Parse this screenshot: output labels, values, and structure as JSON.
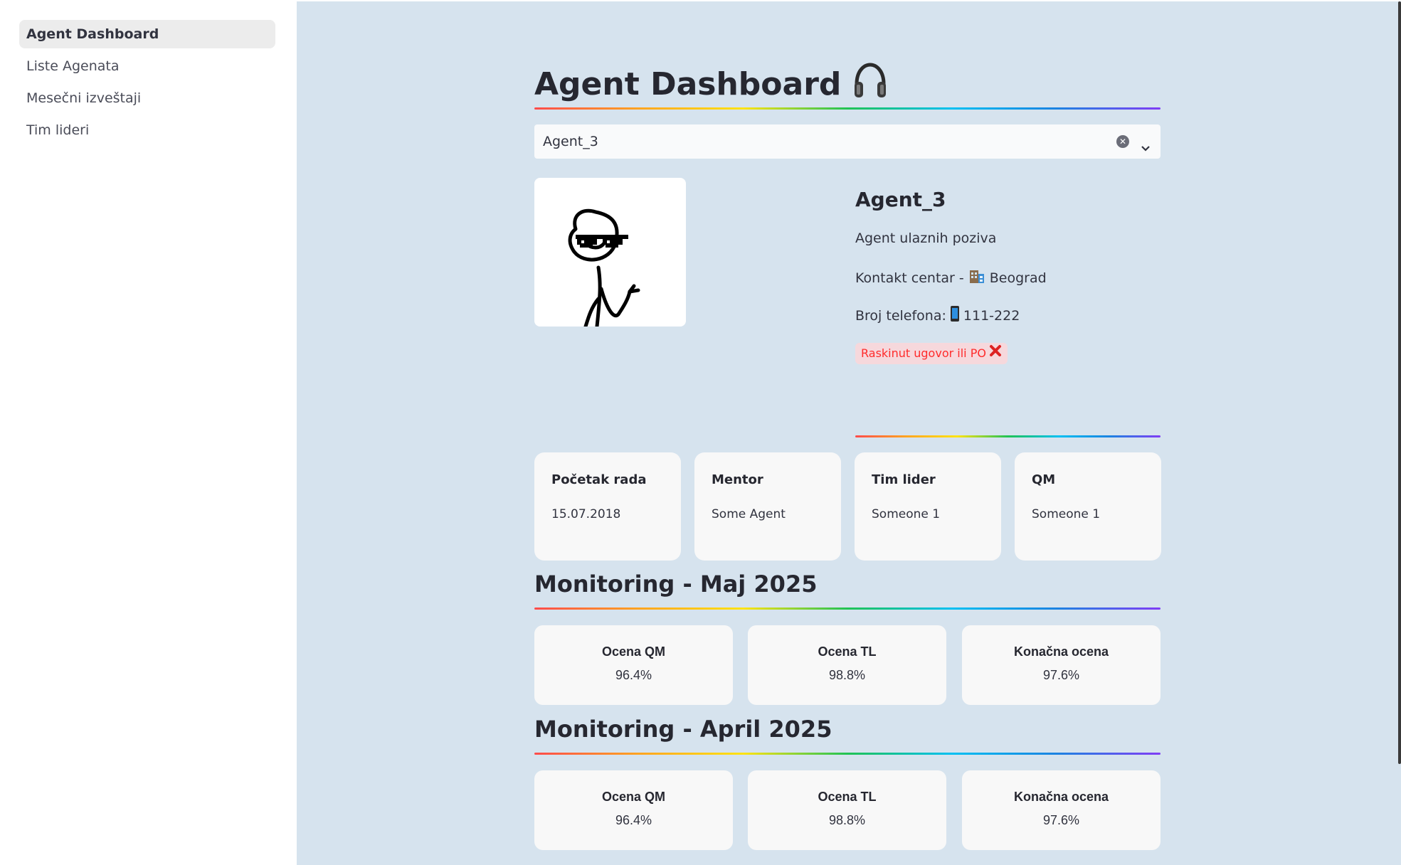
{
  "sidebar": {
    "items": [
      {
        "label": "Agent Dashboard",
        "active": true
      },
      {
        "label": "Liste Agenata",
        "active": false
      },
      {
        "label": "Mesečni izveštaji",
        "active": false
      },
      {
        "label": "Tim lideri",
        "active": false
      }
    ]
  },
  "header": {
    "title": "Agent Dashboard",
    "title_icon": "headphones-icon"
  },
  "agent_select": {
    "value": "Agent_3",
    "clear_icon": "clear-icon",
    "dropdown_icon": "chevron-down-icon"
  },
  "profile": {
    "avatar_icon": "stick-figure-sunglasses-icon",
    "name": "Agent_3",
    "role": "Agent ulaznih poziva",
    "location_prefix": "Kontakt centar -",
    "location_icon": "office-building-icon",
    "location": "Beograd",
    "phone_prefix": "Broj telefona:",
    "phone_icon": "mobile-phone-icon",
    "phone": "111-222",
    "status": "Raskinut ugovor ili PO",
    "status_icon": "cross-mark-icon",
    "status_color": "#ff2b2b"
  },
  "info_cards": [
    {
      "label": "Početak rada",
      "value": "15.07.2018"
    },
    {
      "label": "Mentor",
      "value": "Some Agent"
    },
    {
      "label": "Tim lider",
      "value": "Someone 1"
    },
    {
      "label": "QM",
      "value": "Someone 1"
    }
  ],
  "monitoring": [
    {
      "title": "Monitoring - Maj 2025",
      "metrics": [
        {
          "label": "Ocena QM",
          "value": "96.4%"
        },
        {
          "label": "Ocena TL",
          "value": "98.8%"
        },
        {
          "label": "Konačna ocena",
          "value": "97.6%"
        }
      ]
    },
    {
      "title": "Monitoring - April 2025",
      "metrics": [
        {
          "label": "Ocena QM",
          "value": "96.4%"
        },
        {
          "label": "Ocena TL",
          "value": "98.8%"
        },
        {
          "label": "Konačna ocena",
          "value": "97.6%"
        }
      ]
    }
  ],
  "colors": {
    "main_background": "#d6e3ee",
    "card_background": "#f8f8f8",
    "sidebar_active": "#ececec"
  }
}
